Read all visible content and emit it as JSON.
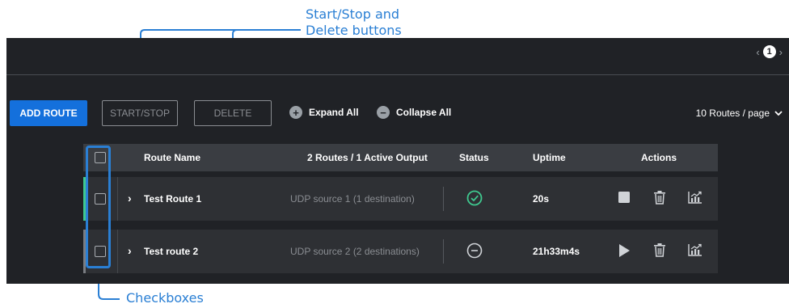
{
  "annotations": {
    "buttons_callout": "Start/Stop and\nDelete buttons",
    "checkboxes_callout": "Checkboxes",
    "accent_color": "#2a7fd4"
  },
  "pager": {
    "prev": "‹",
    "current": "1",
    "next": "›"
  },
  "toolbar": {
    "add_route_label": "ADD ROUTE",
    "start_stop_label": "START/STOP",
    "delete_label": "DELETE",
    "expand_all_label": "Expand All",
    "collapse_all_label": "Collapse All",
    "per_page_label": "10 Routes / page",
    "add_route_color": "#1470dc"
  },
  "table": {
    "headers": {
      "route_name": "Route Name",
      "outputs": "2 Routes / 1 Active Output",
      "status": "Status",
      "uptime": "Uptime",
      "actions": "Actions"
    },
    "rows": [
      {
        "name": "Test Route 1",
        "output": "UDP source 1 (1 destination)",
        "status_icon": "check-circle-icon",
        "uptime": "20s",
        "primary_action_icon": "stop-icon",
        "accent_color": "#3fc98f"
      },
      {
        "name": "Test route 2",
        "output": "UDP source 2 (2 destinations)",
        "status_icon": "minus-circle-icon",
        "uptime": "21h33m4s",
        "primary_action_icon": "play-icon",
        "accent_color": "#7a7d82"
      }
    ]
  }
}
